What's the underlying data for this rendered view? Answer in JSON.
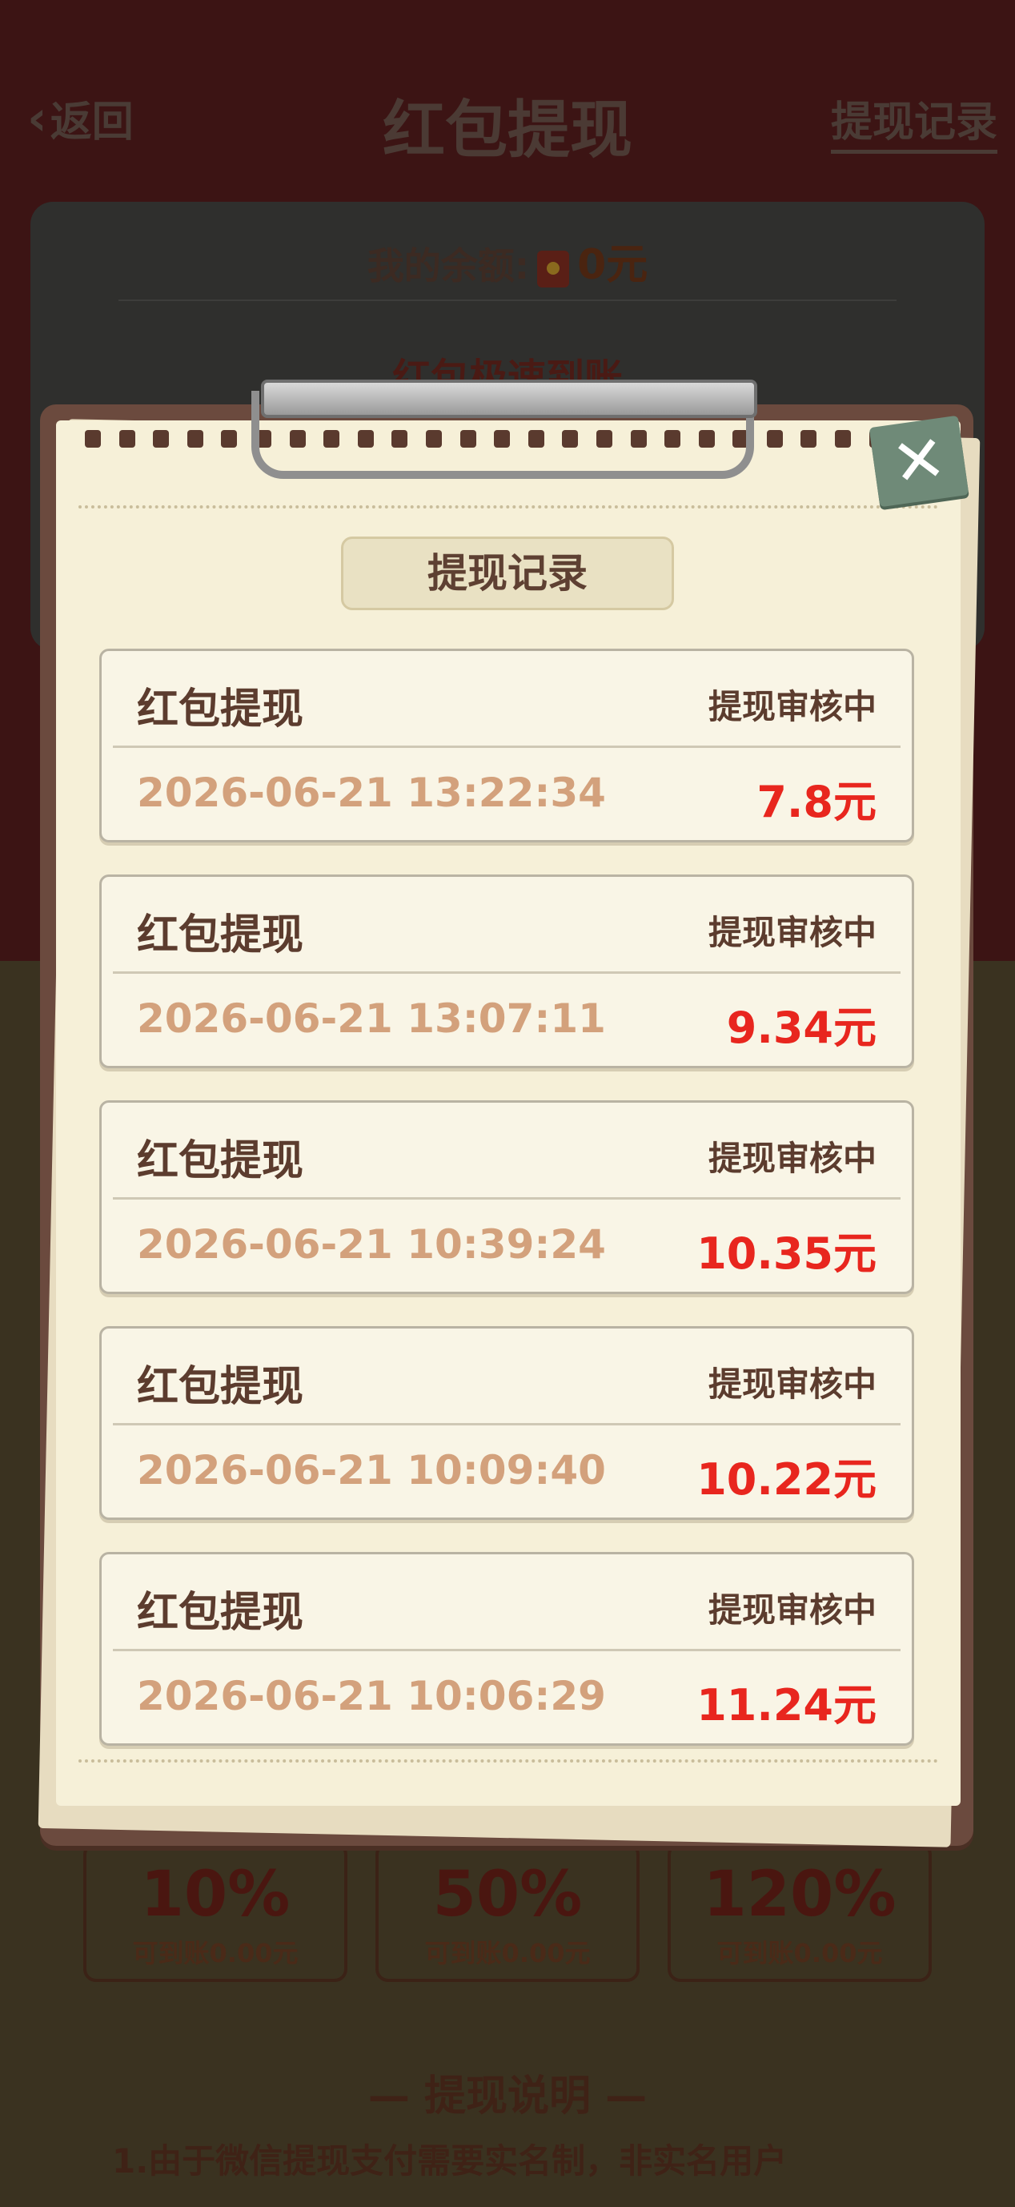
{
  "nav": {
    "back_label": "返回",
    "title": "红包提现",
    "record_label": "提现记录"
  },
  "balance": {
    "label": "我的余额:",
    "amount": "0元",
    "subtitle": "红包极速到账"
  },
  "percent_options": [
    {
      "pct": "10%",
      "sub": "可到账0.00元"
    },
    {
      "pct": "50%",
      "sub": "可到账0.00元"
    },
    {
      "pct": "120%",
      "sub": "可到账0.00元"
    }
  ],
  "explain": {
    "title": "— 提现说明 —",
    "line1": "1.由于微信提现支付需要实名制，非实名用户"
  },
  "modal": {
    "title": "提现记录",
    "close_symbol": "✕",
    "records": [
      {
        "name": "红包提现",
        "status": "提现审核中",
        "time": "2026-06-21 13:22:34",
        "amount": "7.8元"
      },
      {
        "name": "红包提现",
        "status": "提现审核中",
        "time": "2026-06-21 13:07:11",
        "amount": "9.34元"
      },
      {
        "name": "红包提现",
        "status": "提现审核中",
        "time": "2026-06-21 10:39:24",
        "amount": "10.35元"
      },
      {
        "name": "红包提现",
        "status": "提现审核中",
        "time": "2026-06-21 10:09:40",
        "amount": "10.22元"
      },
      {
        "name": "红包提现",
        "status": "提现审核中",
        "time": "2026-06-21 10:06:29",
        "amount": "11.24元"
      }
    ]
  },
  "colors": {
    "amount_red": "#e8261e",
    "time_tan": "#d3a17c",
    "text_brown": "#5c3c2e",
    "paper": "#f6f0d8",
    "board": "#6b4a3e",
    "close_green": "#6f8a78"
  }
}
